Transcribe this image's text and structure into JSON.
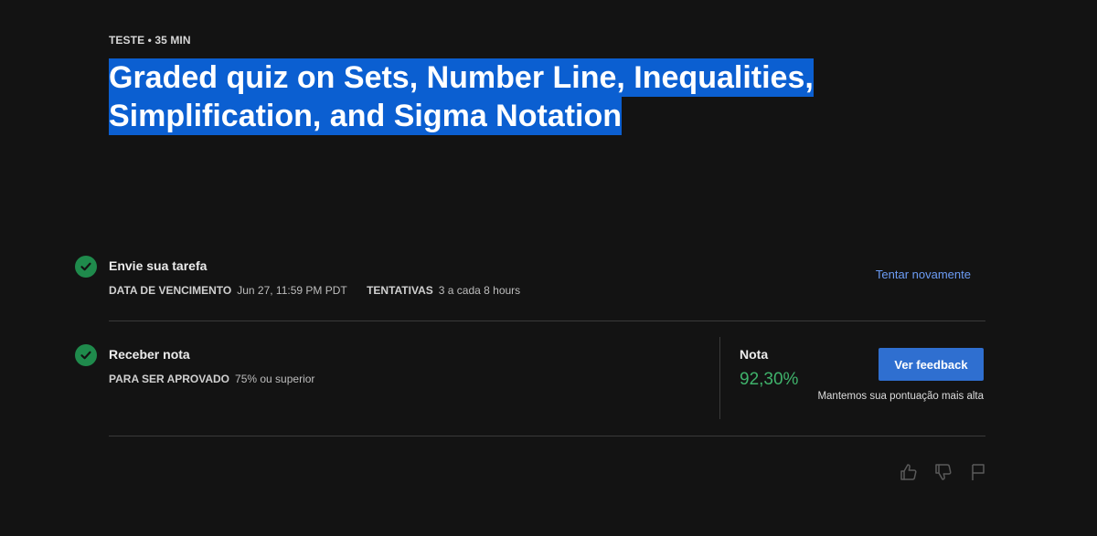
{
  "header": {
    "meta": "TESTE • 35 MIN",
    "title_line1": "Graded quiz on Sets, Number Line, Inequalities,",
    "title_line2": "Simplification, and Sigma Notation"
  },
  "submit": {
    "title": "Envie sua tarefa",
    "due_label": "DATA DE VENCIMENTO",
    "due_value": "Jun 27, 11:59 PM PDT",
    "attempts_label": "TENTATIVAS",
    "attempts_value": "3 a cada 8 hours",
    "retry_link": "Tentar novamente"
  },
  "grade": {
    "title": "Receber nota",
    "pass_label": "PARA SER APROVADO",
    "pass_value": "75% ou superior",
    "grade_label": "Nota",
    "grade_value": "92,30%",
    "feedback_button": "Ver feedback",
    "keep_note": "Mantemos sua pontuação mais alta"
  },
  "icons": {
    "check": "check-circle-icon",
    "like": "thumbs-up-icon",
    "dislike": "thumbs-down-icon",
    "flag": "flag-icon"
  },
  "colors": {
    "background": "#131313",
    "title_highlight": "#0b5fd1",
    "success": "#1f8a4c",
    "grade_text": "#3fb26b",
    "link": "#6c9cf5",
    "button": "#2f6fd0"
  }
}
